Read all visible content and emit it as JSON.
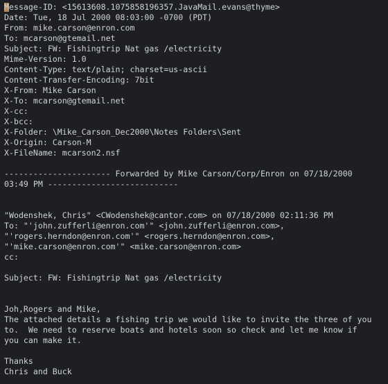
{
  "email": {
    "header_lines": [
      "Message-ID: <15613608.1075858196357.JavaMail.evans@thyme>",
      "Date: Tue, 18 Jul 2000 08:03:00 -0700 (PDT)",
      "From: mike.carson@enron.com",
      "To: mcarson@gtemail.net",
      "Subject: FW: Fishingtrip Nat gas /electricity",
      "Mime-Version: 1.0",
      "Content-Type: text/plain; charset=us-ascii",
      "Content-Transfer-Encoding: 7bit",
      "X-From: Mike Carson",
      "X-To: mcarson@gtemail.net",
      "X-cc: ",
      "X-bcc: ",
      "X-Folder: \\Mike_Carson_Dec2000\\Notes Folders\\Sent",
      "X-Origin: Carson-M",
      "X-FileName: mcarson2.nsf"
    ],
    "body_lines": [
      "",
      "---------------------- Forwarded by Mike Carson/Corp/Enron on 07/18/2000",
      "03:49 PM ---------------------------",
      "",
      "",
      "\"Wodenshek, Chris\" <CWodenshek@cantor.com> on 07/18/2000 02:11:36 PM",
      "To: \"'john.zufferli@enron.com'\" <john.zufferli@enron.com>,",
      "\"'rogers.herndon@enron.com'\" <rogers.herndon@enron.com>,",
      "\"'mike.carson@enron.com'\" <mike.carson@enron.com>",
      "cc: ",
      "",
      "Subject: FW: Fishingtrip Nat gas /electricity",
      "",
      "",
      "Joh,Rogers and Mike,",
      "The attached details a fishing trip we would like to invite the three of you",
      "to.  We need to reserve boats and hotels soon so check and let me know if",
      "you can make it.",
      "",
      "Thanks",
      "Chris and Buck"
    ]
  }
}
